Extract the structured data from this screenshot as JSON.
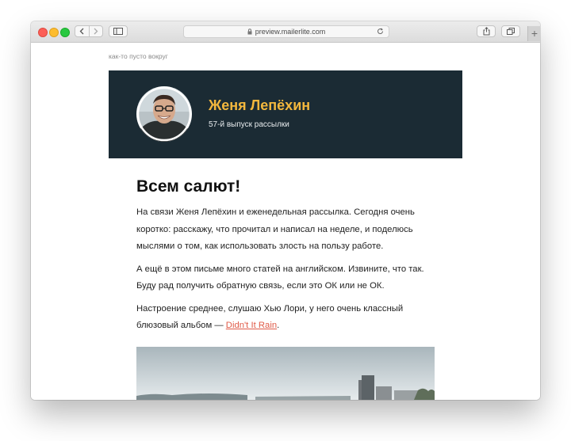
{
  "browser": {
    "url": "preview.mailerlite.com",
    "new_tab_label": "+"
  },
  "email": {
    "preheader": "как-то пусто вокруг",
    "header": {
      "name": "Женя Лепёхин",
      "issue": "57-й выпуск рассылки"
    },
    "greeting": "Всем салют!",
    "paragraph1": "На связи Женя Лепёхин и еженедельная рассылка. Сегодня очень коротко: расскажу, что прочитал и написал на неделе, и поделюсь мыслями о том, как использовать злость на пользу работе.",
    "paragraph2": "А ещё в этом письме много статей на английском. Извините, что так. Буду рад получить обратную связь, если это ОК или не ОК.",
    "paragraph3_before": "Настроение среднее, слушаю Хью Лори, у него очень классный блюзовый альбом — ",
    "song_link": "Didn't It Rain",
    "paragraph3_after": "."
  },
  "colors": {
    "hero_bg": "#1b2b34",
    "name_accent": "#f3b73d",
    "link": "#e05a47"
  }
}
